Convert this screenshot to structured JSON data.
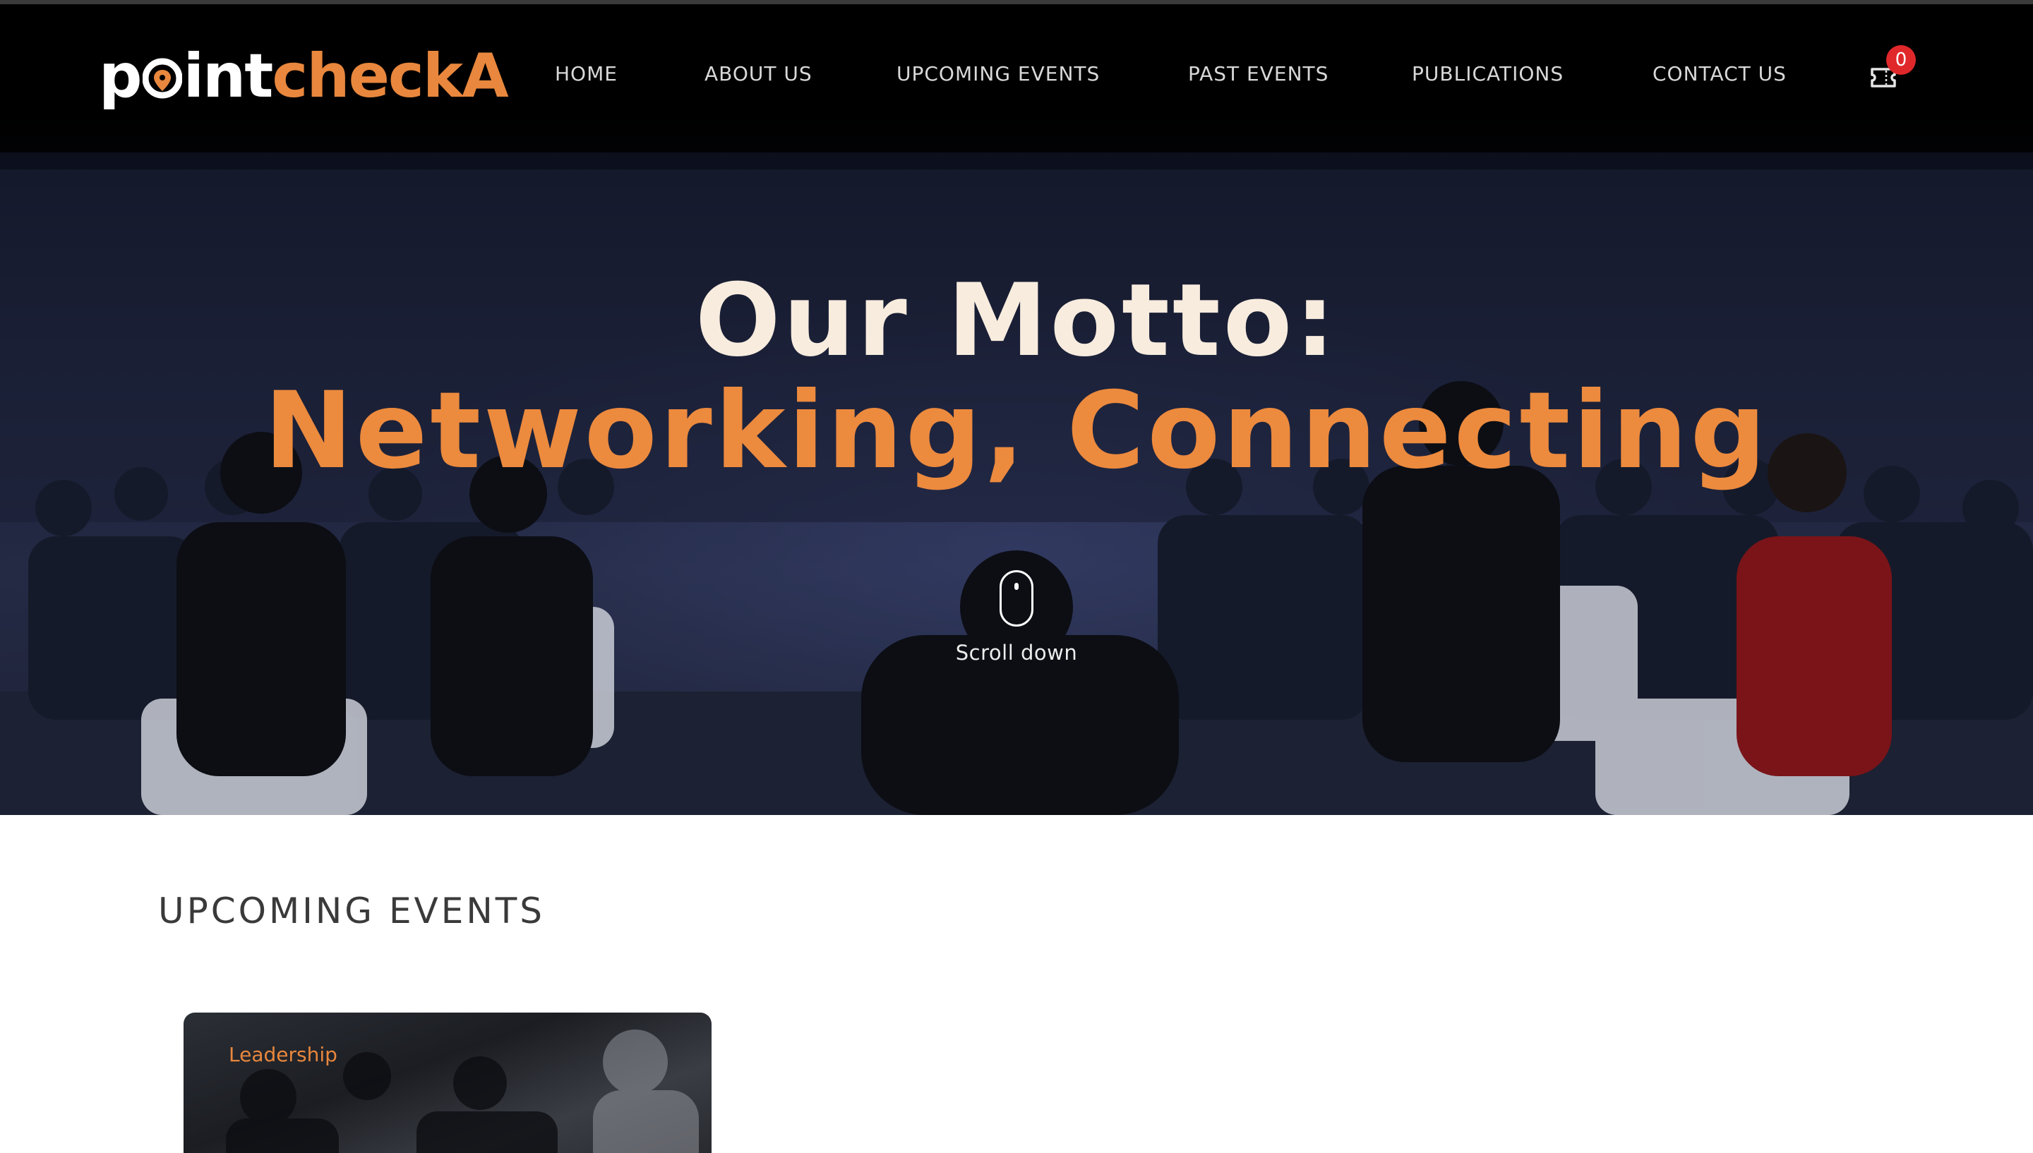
{
  "brand": {
    "logo_part1": "p",
    "logo_part2": "int",
    "logo_part3": "checkA",
    "colors": {
      "accent": "#e8873d",
      "title": "#f7ecde",
      "badge": "#e0282b"
    }
  },
  "nav": {
    "items": [
      {
        "label": "HOME"
      },
      {
        "label": "ABOUT US"
      },
      {
        "label": "UPCOMING EVENTS"
      },
      {
        "label": "PAST EVENTS"
      },
      {
        "label": "PUBLICATIONS"
      },
      {
        "label": "CONTACT US"
      }
    ],
    "cart_icon": "ticket-icon",
    "cart_count": "0"
  },
  "hero": {
    "line1": "Our Motto:",
    "line2": "Networking, Connecting",
    "scroll_label": "Scroll down",
    "scroll_icon": "mouse-icon"
  },
  "upcoming": {
    "title": "UPCOMING EVENTS",
    "cards": [
      {
        "tag": "Leadership"
      }
    ]
  }
}
